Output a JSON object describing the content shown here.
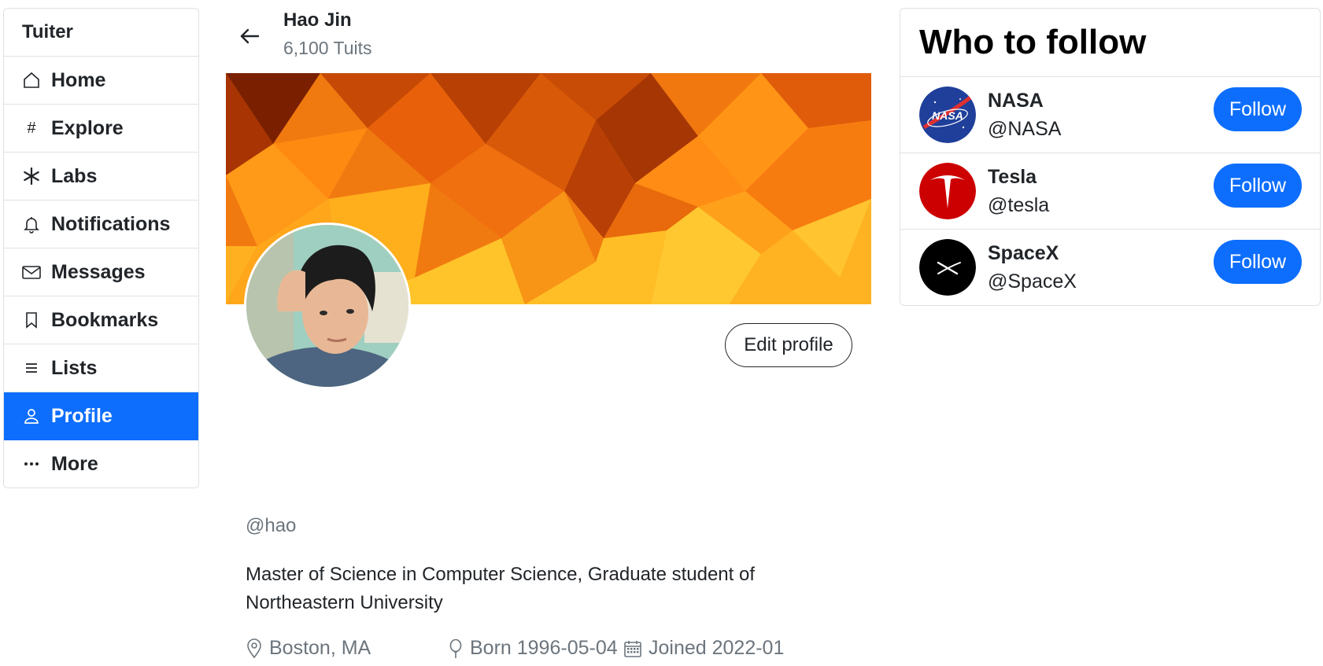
{
  "nav": {
    "brand": "Tuiter",
    "items": [
      {
        "label": "Home",
        "icon": "home-icon"
      },
      {
        "label": "Explore",
        "icon": "hash-icon"
      },
      {
        "label": "Labs",
        "icon": "asterisk-icon"
      },
      {
        "label": "Notifications",
        "icon": "bell-icon"
      },
      {
        "label": "Messages",
        "icon": "envelope-icon"
      },
      {
        "label": "Bookmarks",
        "icon": "bookmark-icon"
      },
      {
        "label": "Lists",
        "icon": "list-icon"
      },
      {
        "label": "Profile",
        "icon": "person-icon",
        "active": true
      },
      {
        "label": "More",
        "icon": "ellipsis-icon"
      }
    ]
  },
  "profile": {
    "name": "Hao Jin",
    "tuits": "6,100 Tuits",
    "edit_label": "Edit profile",
    "handle": "@hao",
    "bio": "Master of Science in Computer Science, Graduate student of Northeastern University",
    "location": "Boston, MA",
    "born": "Born 1996-05-04",
    "joined": "Joined 2022-01"
  },
  "who_to_follow": {
    "title": "Who to follow",
    "accounts": [
      {
        "name": "NASA",
        "handle": "@NASA",
        "button": "Follow",
        "logo_text": "NASA"
      },
      {
        "name": "Tesla",
        "handle": "@tesla",
        "button": "Follow"
      },
      {
        "name": "SpaceX",
        "handle": "@SpaceX",
        "button": "Follow"
      }
    ]
  },
  "colors": {
    "accent": "#0d6efd",
    "muted": "#6c757d",
    "border": "#dee2e6",
    "tesla_red": "#cc0000"
  }
}
